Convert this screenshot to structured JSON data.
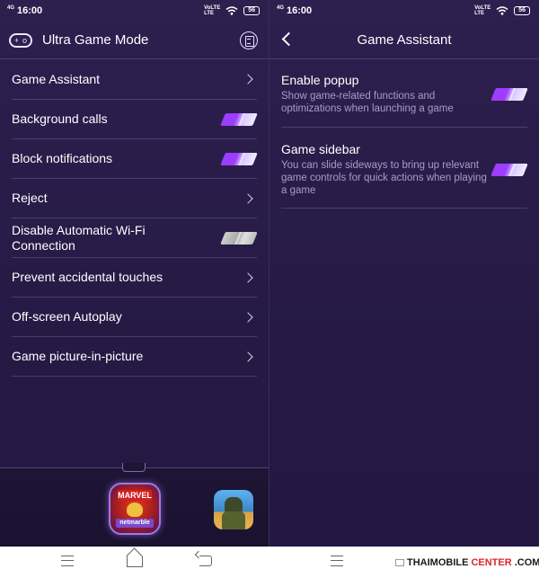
{
  "status_bar": {
    "time": "16:00",
    "network": "4G",
    "volte_top": "VoLTE",
    "volte_bottom": "LTE",
    "battery": "56"
  },
  "left_screen": {
    "title": "Ultra Game Mode",
    "menu_items": [
      {
        "label": "Game Assistant",
        "control": "chevron"
      },
      {
        "label": "Background calls",
        "control": "toggle",
        "state": "on"
      },
      {
        "label": "Block notifications",
        "control": "toggle",
        "state": "on"
      },
      {
        "label": "Reject",
        "control": "chevron"
      },
      {
        "label": "Disable Automatic Wi-Fi Connection",
        "control": "toggle",
        "state": "off"
      },
      {
        "label": "Prevent accidental touches",
        "control": "chevron"
      },
      {
        "label": "Off-screen Autoplay",
        "control": "chevron"
      },
      {
        "label": "Game picture-in-picture",
        "control": "chevron"
      }
    ],
    "dock": {
      "apps": [
        {
          "name": "marvel-future-fight-app",
          "top_text": "MARVEL",
          "bottom_text": "netmarble"
        },
        {
          "name": "pubg-mobile-app"
        }
      ]
    }
  },
  "right_screen": {
    "title": "Game Assistant",
    "settings": [
      {
        "title": "Enable popup",
        "description": "Show game-related functions and optimizations when launching a game",
        "state": "on"
      },
      {
        "title": "Game sidebar",
        "description": "You can slide sideways to bring up relevant game controls for quick actions when playing a game",
        "state": "on"
      }
    ]
  },
  "watermark": {
    "part1": "THAIMOBILE",
    "part2": "CENTER",
    "part3": ".COM",
    "symbol": "©"
  },
  "colors": {
    "background": "#2d1f4e",
    "toggle_on": "#9d3dff",
    "toggle_off": "#bdbdbd",
    "watermark_accent": "#e0252b"
  }
}
